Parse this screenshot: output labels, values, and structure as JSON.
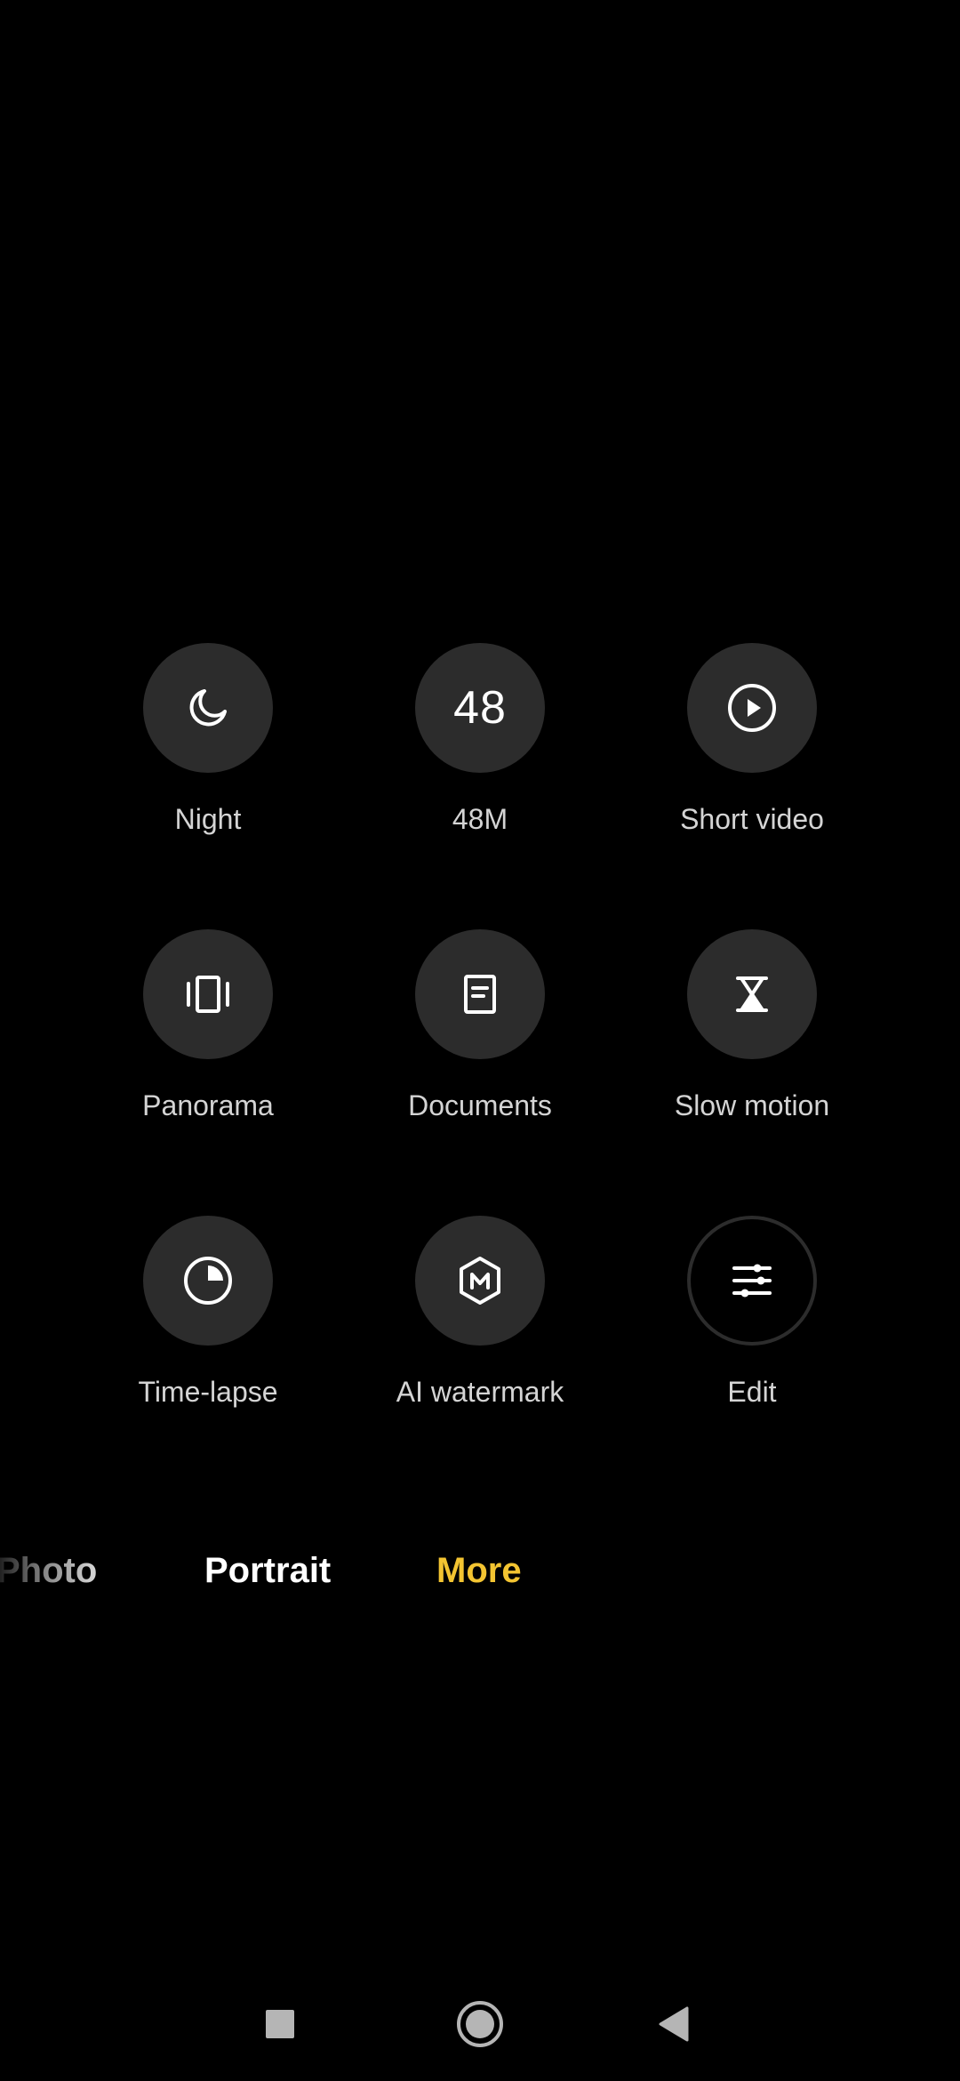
{
  "modes_grid": {
    "items": [
      {
        "label": "Night",
        "icon": "moon-icon"
      },
      {
        "label": "48M",
        "icon": "48-text-icon",
        "glyph": "48"
      },
      {
        "label": "Short video",
        "icon": "play-circle-icon"
      },
      {
        "label": "Panorama",
        "icon": "panorama-icon"
      },
      {
        "label": "Documents",
        "icon": "document-icon"
      },
      {
        "label": "Slow motion",
        "icon": "hourglass-icon"
      },
      {
        "label": "Time-lapse",
        "icon": "timer-icon"
      },
      {
        "label": "AI watermark",
        "icon": "watermark-hexagon-icon"
      },
      {
        "label": "Edit",
        "icon": "sliders-icon"
      }
    ]
  },
  "mode_bar": {
    "photo": "Photo",
    "portrait": "Portrait",
    "more": "More",
    "active": "More",
    "active_color": "#f3c431"
  },
  "nav_bar": {
    "recents": "recents-square-icon",
    "home": "home-circle-icon",
    "back": "back-triangle-icon"
  },
  "colors": {
    "background": "#000000",
    "tile": "#2c2c2c",
    "accent": "#f3c431"
  }
}
